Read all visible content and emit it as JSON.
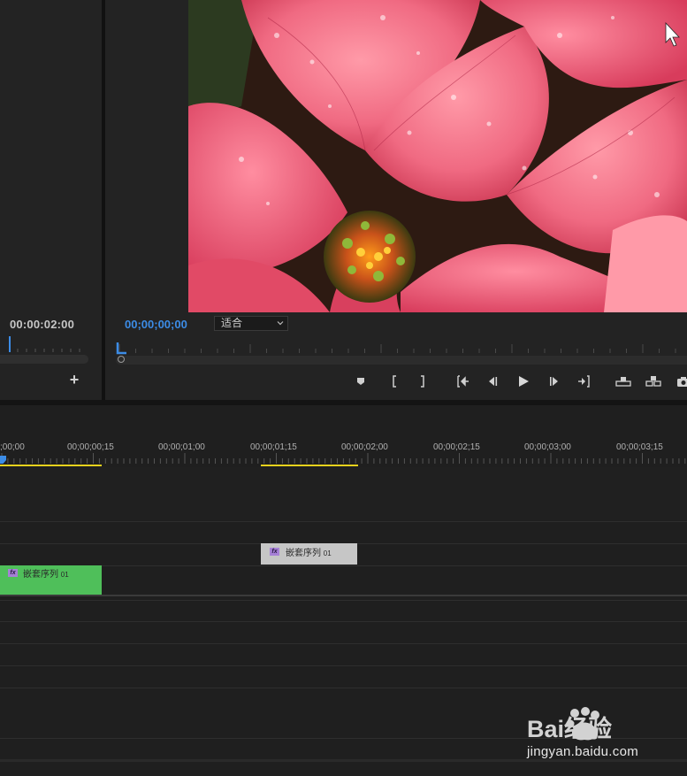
{
  "source_monitor": {
    "timecode": "00:00:02:00",
    "add_label": "+"
  },
  "program_monitor": {
    "timecode": "00;00;00;00",
    "fit_value": "适合",
    "transport_icons": [
      "add-marker-icon",
      "mark-in-icon",
      "mark-out-icon",
      "go-to-in-icon",
      "step-back-icon",
      "play-icon",
      "step-forward-icon",
      "go-to-out-icon",
      "lift-icon",
      "extract-icon",
      "export-frame-icon"
    ]
  },
  "timeline": {
    "ruler_labels": [
      ";00;00",
      "00;00;00;15",
      "00;00;01;00",
      "00;00;01;15",
      "00;00;02;00",
      "00;00;02;15",
      "00;00;03;00",
      "00;00;03;15"
    ],
    "clips": [
      {
        "name": "嵌套序列",
        "suffix": "01",
        "fx": "fx",
        "color": "#c6c6c6"
      },
      {
        "name": "嵌套序列",
        "suffix": "01",
        "fx": "fx",
        "color": "#4fbf5a"
      }
    ],
    "work_area_color": "#e8d21c",
    "playhead_color": "#3c8ce6"
  },
  "watermark": {
    "brand": "Bai经验",
    "url": "jingyan.baidu.com"
  }
}
